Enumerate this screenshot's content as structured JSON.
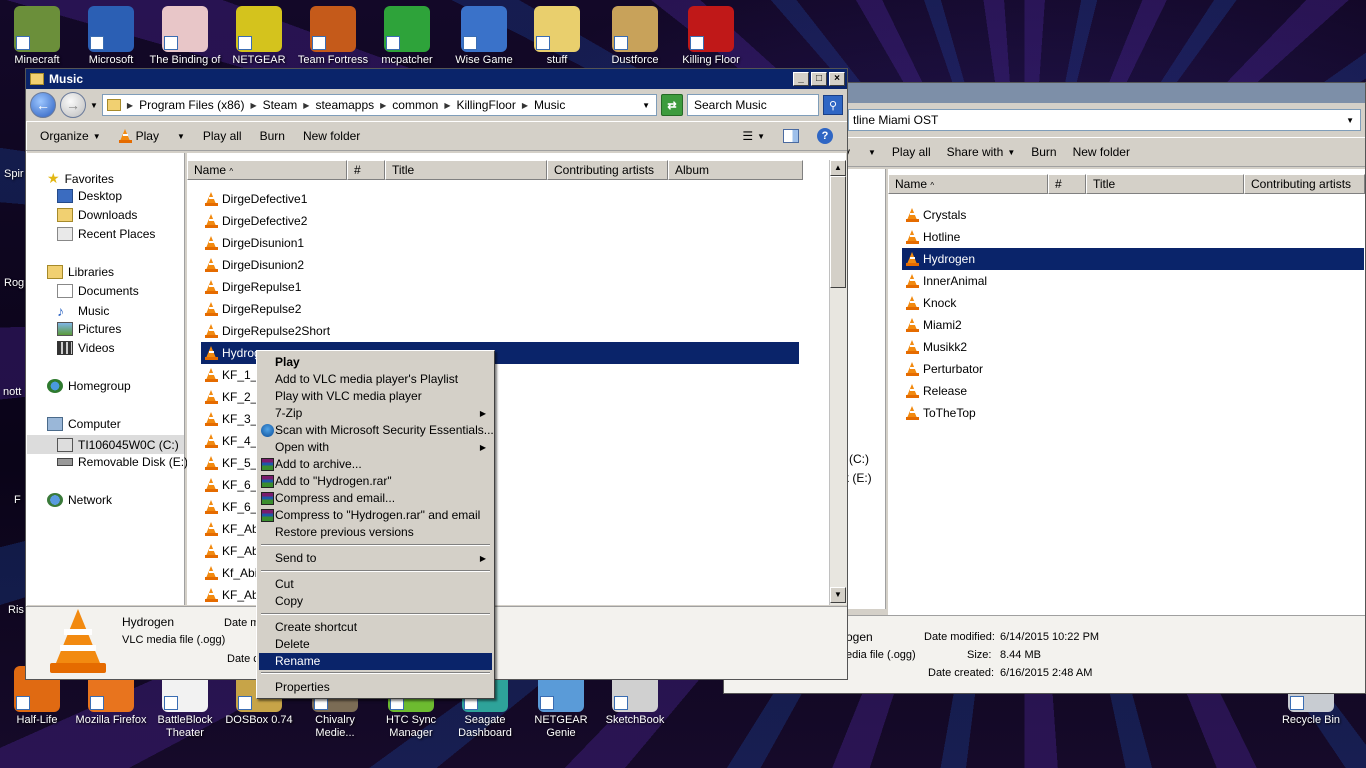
{
  "desktop": {
    "top_icons": [
      {
        "label": "Minecraft",
        "color": "#6b8f3a"
      },
      {
        "label": "Microsoft",
        "color": "#2b5fb4"
      },
      {
        "label": "The Binding of",
        "color": "#e8c6c8"
      },
      {
        "label": "NETGEAR",
        "color": "#d4c31d"
      },
      {
        "label": "Team Fortress",
        "color": "#c55a1a"
      },
      {
        "label": "mcpatcher",
        "color": "#2ea33a"
      },
      {
        "label": "Wise Game",
        "color": "#3a72c9"
      },
      {
        "label": "stuff",
        "color": "#e9cf6d"
      },
      {
        "label": "Dustforce",
        "color": "#c8a25a"
      },
      {
        "label": "Killing Floor",
        "color": "#c01818"
      }
    ],
    "bottom_icons": [
      {
        "label": "Half-Life",
        "color": "#e06a12"
      },
      {
        "label": "Mozilla Firefox",
        "color": "#e8741e"
      },
      {
        "label": "BattleBlock Theater",
        "color": "#f2f2f2"
      },
      {
        "label": "DOSBox 0.74",
        "color": "#c7a448"
      },
      {
        "label": "Chivalry Medie...",
        "color": "#7b6c55"
      },
      {
        "label": "HTC Sync Manager",
        "color": "#6dbb30"
      },
      {
        "label": "Seagate Dashboard",
        "color": "#2ea39a"
      },
      {
        "label": "NETGEAR Genie",
        "color": "#5a9bd8"
      },
      {
        "label": "SketchBook",
        "color": "#d0d0d0"
      },
      {
        "label": "Recycle Bin",
        "color": "#c8ccd2"
      }
    ],
    "side_labels": [
      "Spir",
      "Rog",
      "nott",
      "F",
      "Ris"
    ]
  },
  "music_window": {
    "title": "Music",
    "breadcrumb": [
      "Program Files (x86)",
      "Steam",
      "steamapps",
      "common",
      "KillingFloor",
      "Music"
    ],
    "search_placeholder": "Search Music",
    "toolbar": {
      "organize": "Organize",
      "play": "Play",
      "play_all": "Play all",
      "burn": "Burn",
      "new_folder": "New folder"
    },
    "nav": {
      "favorites": "Favorites",
      "favorites_items": [
        "Desktop",
        "Downloads",
        "Recent Places"
      ],
      "libraries": "Libraries",
      "libraries_items": [
        "Documents",
        "Music",
        "Pictures",
        "Videos"
      ],
      "homegroup": "Homegroup",
      "computer": "Computer",
      "computer_items": [
        "TI106045W0C (C:)",
        "Removable Disk (E:)"
      ],
      "network": "Network"
    },
    "columns": [
      "Name",
      "#",
      "Title",
      "Contributing artists",
      "Album"
    ],
    "files": [
      "DirgeDefective1",
      "DirgeDefective2",
      "DirgeDisunion1",
      "DirgeDisunion2",
      "DirgeRepulse1",
      "DirgeRepulse2",
      "DirgeRepulse2Short",
      "Hydrogen",
      "KF_1_L",
      "KF_2_W",
      "KF_3_G",
      "KF_4_B",
      "KF_5_T",
      "KF_6_T",
      "KF_6_",
      "KF_Aba",
      "KF_Aba",
      "Kf_Abi",
      "KF_Abi"
    ],
    "selected_file": "Hydrogen",
    "details": {
      "name": "Hydrogen",
      "type": "VLC media file (.ogg)",
      "date_modified_label": "Date m",
      "date_created_label": "Date c"
    }
  },
  "context_menu": {
    "items": [
      {
        "label": "Play",
        "bold": true
      },
      {
        "label": "Add to VLC media player's Playlist"
      },
      {
        "label": "Play with VLC media player"
      },
      {
        "label": "7-Zip",
        "submenu": true
      },
      {
        "label": "Scan with Microsoft Security Essentials...",
        "icon": "shield-icon"
      },
      {
        "label": "Open with",
        "submenu": true
      },
      {
        "label": "Add to archive...",
        "icon": "winrar-icon"
      },
      {
        "label": "Add to \"Hydrogen.rar\"",
        "icon": "winrar-icon"
      },
      {
        "label": "Compress and email...",
        "icon": "winrar-icon"
      },
      {
        "label": "Compress to \"Hydrogen.rar\" and email",
        "icon": "winrar-icon"
      },
      {
        "label": "Restore previous versions"
      },
      {
        "label": "Send to",
        "submenu": true
      },
      {
        "label": "Cut"
      },
      {
        "label": "Copy"
      },
      {
        "label": "Create shortcut"
      },
      {
        "label": "Delete"
      },
      {
        "label": "Rename",
        "selected": true
      },
      {
        "label": "Properties"
      }
    ]
  },
  "ost_window": {
    "breadcrumb_tail": "tline Miami OST",
    "toolbar": {
      "play_all": "Play all",
      "share_with": "Share with",
      "burn": "Burn",
      "new_folder": "New folder",
      "play_fragment": "y"
    },
    "columns": [
      "Name",
      "#",
      "Title",
      "Contributing artists"
    ],
    "files": [
      "Crystals",
      "Hotline",
      "Hydrogen",
      "InnerAnimal",
      "Knock",
      "Miami2",
      "Musikk2",
      "Perturbator",
      "Release",
      "ToTheTop"
    ],
    "selected_file": "Hydrogen",
    "nav_fragments": [
      "(C:)",
      "k (E:)"
    ],
    "details": {
      "name_fragment": "ogen",
      "type_fragment": "edia file (.ogg)",
      "date_modified_label": "Date modified:",
      "date_modified": "6/14/2015 10:22 PM",
      "size_label": "Size:",
      "size": "8.44 MB",
      "date_created_label": "Date created:",
      "date_created": "6/16/2015 2:48 AM"
    }
  }
}
